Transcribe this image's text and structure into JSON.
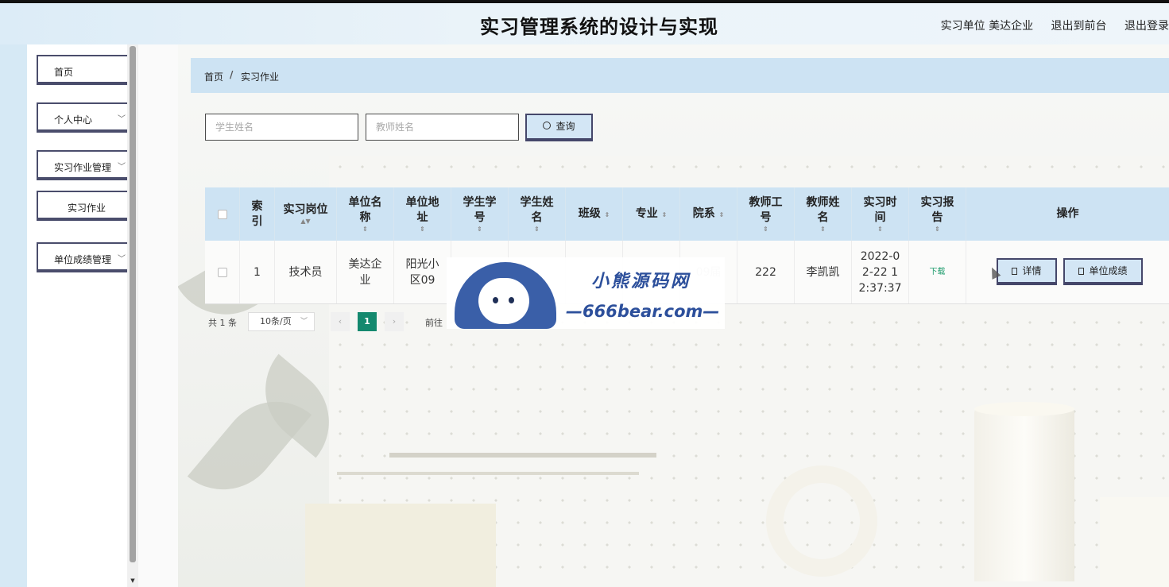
{
  "header": {
    "title": "实习管理系统的设计与实现",
    "unit_label": "实习单位 美达企业",
    "front_label": "退出到前台",
    "logout_label": "退出登录"
  },
  "sidebar": {
    "items": [
      {
        "label": "首页"
      },
      {
        "label": "个人中心"
      },
      {
        "label": "实习作业管理"
      },
      {
        "label": "实习作业"
      },
      {
        "label": "单位成绩管理"
      }
    ]
  },
  "breadcrumb": {
    "home": "首页",
    "separator": "/",
    "current": "实习作业"
  },
  "search": {
    "student_placeholder": "学生姓名",
    "teacher_placeholder": "教师姓名",
    "query_label": "查询"
  },
  "table": {
    "headers": [
      "索\n引",
      "实习岗位",
      "单位名\n称",
      "单位地\n址",
      "学生学\n号",
      "学生姓\n名",
      "班级",
      "专业",
      "院系",
      "教师工\n号",
      "教师姓\n名",
      "实习时\n间",
      "实习报\n告",
      "操作"
    ],
    "rows": [
      {
        "index": "1",
        "position": "技术员",
        "company": "美达企\n业",
        "address": "阳光小\n区09",
        "student_no": "",
        "student_name": "",
        "class": "",
        "major": "",
        "department": "09届",
        "teacher_no": "222",
        "teacher_name": "李凯凯",
        "time": "2022-0\n2-22 1\n2:37:37",
        "report": "下载",
        "detail_label": "详情",
        "score_label": "单位成绩"
      }
    ]
  },
  "pagination": {
    "total": "共 1 条",
    "page_size": "10条/页",
    "current_page": "1",
    "goto": "前往"
  },
  "watermark": {
    "text": "小熊源码网",
    "url": "—666bear.com—"
  },
  "colors": {
    "accent": "#14896e",
    "header_bg": "#cde3f3",
    "border": "#45476a"
  }
}
